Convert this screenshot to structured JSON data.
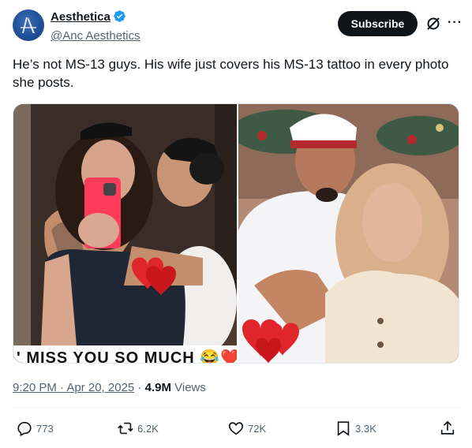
{
  "author": {
    "display_name": "Aesthetica",
    "handle": "@Anc Aesthetics",
    "verified": true,
    "avatar_icon": "brand-logo-avatar"
  },
  "header_actions": {
    "subscribe_label": "Subscribe",
    "grok_icon": "grok-icon",
    "more_icon": "more-horizontal-icon",
    "more_label": "···"
  },
  "tweet": {
    "text": "He’s not MS-13 guys. His wife just covers his MS-13 tattoo in every photo she posts."
  },
  "media": {
    "left_caption": "' MISS YOU SO MUCH 😂❤️"
  },
  "meta": {
    "time": "9:20 PM · Apr 20, 2025",
    "separator": " · ",
    "views_count": "4.9M",
    "views_label": " Views"
  },
  "actions": {
    "reply": {
      "icon": "reply-icon",
      "count": "773"
    },
    "repost": {
      "icon": "repost-icon",
      "count": "6.2K"
    },
    "like": {
      "icon": "heart-icon",
      "count": "72K"
    },
    "bookmark": {
      "icon": "bookmark-icon",
      "count": "3.3K"
    },
    "share": {
      "icon": "share-icon"
    }
  },
  "colors": {
    "text_primary": "#0f1419",
    "text_secondary": "#536471",
    "verified_blue": "#1d9bf0",
    "subscribe_bg": "#0f1419",
    "heart_red": "#e0262b"
  }
}
